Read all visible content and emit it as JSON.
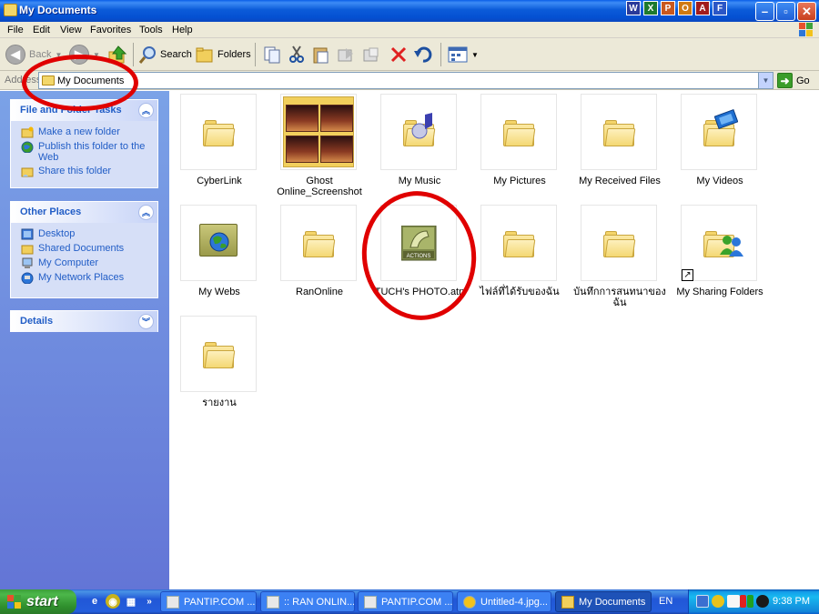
{
  "window": {
    "title": "My Documents"
  },
  "title_bar_apps": [
    "W",
    "X",
    "P",
    "O",
    "A",
    "F"
  ],
  "menu": [
    "File",
    "Edit",
    "View",
    "Favorites",
    "Tools",
    "Help"
  ],
  "toolbar": {
    "back_label": "Back",
    "search_label": "Search",
    "folders_label": "Folders"
  },
  "address": {
    "label": "Address",
    "value": "My Documents",
    "go_label": "Go"
  },
  "left_pane": {
    "file_folder_tasks": {
      "title": "File and Folder Tasks",
      "items": [
        "Make a new folder",
        "Publish this folder to the Web",
        "Share this folder"
      ]
    },
    "other_places": {
      "title": "Other Places",
      "items": [
        "Desktop",
        "Shared Documents",
        "My Computer",
        "My Network Places"
      ]
    },
    "details": {
      "title": "Details"
    }
  },
  "files": [
    {
      "name": "CyberLink",
      "icon": "folder-icon"
    },
    {
      "name": "Ghost Online_Screenshot",
      "icon": "screenshot-folder-icon"
    },
    {
      "name": "My Music",
      "icon": "music-folder-icon"
    },
    {
      "name": "My Pictures",
      "icon": "folder-icon"
    },
    {
      "name": "My Received Files",
      "icon": "folder-icon"
    },
    {
      "name": "My Videos",
      "icon": "video-folder-icon"
    },
    {
      "name": "My Webs",
      "icon": "web-folder-icon"
    },
    {
      "name": "RanOnline",
      "icon": "folder-icon"
    },
    {
      "name": "TUCH's PHOTO.atn",
      "icon": "photoshop-actions-icon"
    },
    {
      "name": "ไฟล์ที่ได้รับของฉัน",
      "icon": "folder-icon"
    },
    {
      "name": "บันทึกการสนทนาของฉัน",
      "icon": "folder-icon"
    },
    {
      "name": "My Sharing Folders",
      "icon": "shared-folder-shortcut-icon"
    },
    {
      "name": "รายงาน",
      "icon": "folder-icon"
    }
  ],
  "taskbar": {
    "start_label": "start",
    "buttons": [
      {
        "label": "PANTIP.COM ..."
      },
      {
        "label": ":: RAN ONLIN..."
      },
      {
        "label": "PANTIP.COM ..."
      },
      {
        "label": "Untitled-4.jpg..."
      },
      {
        "label": "My Documents"
      }
    ],
    "language": "EN",
    "clock": "9:38 PM"
  },
  "annotation_color": "#e00000"
}
